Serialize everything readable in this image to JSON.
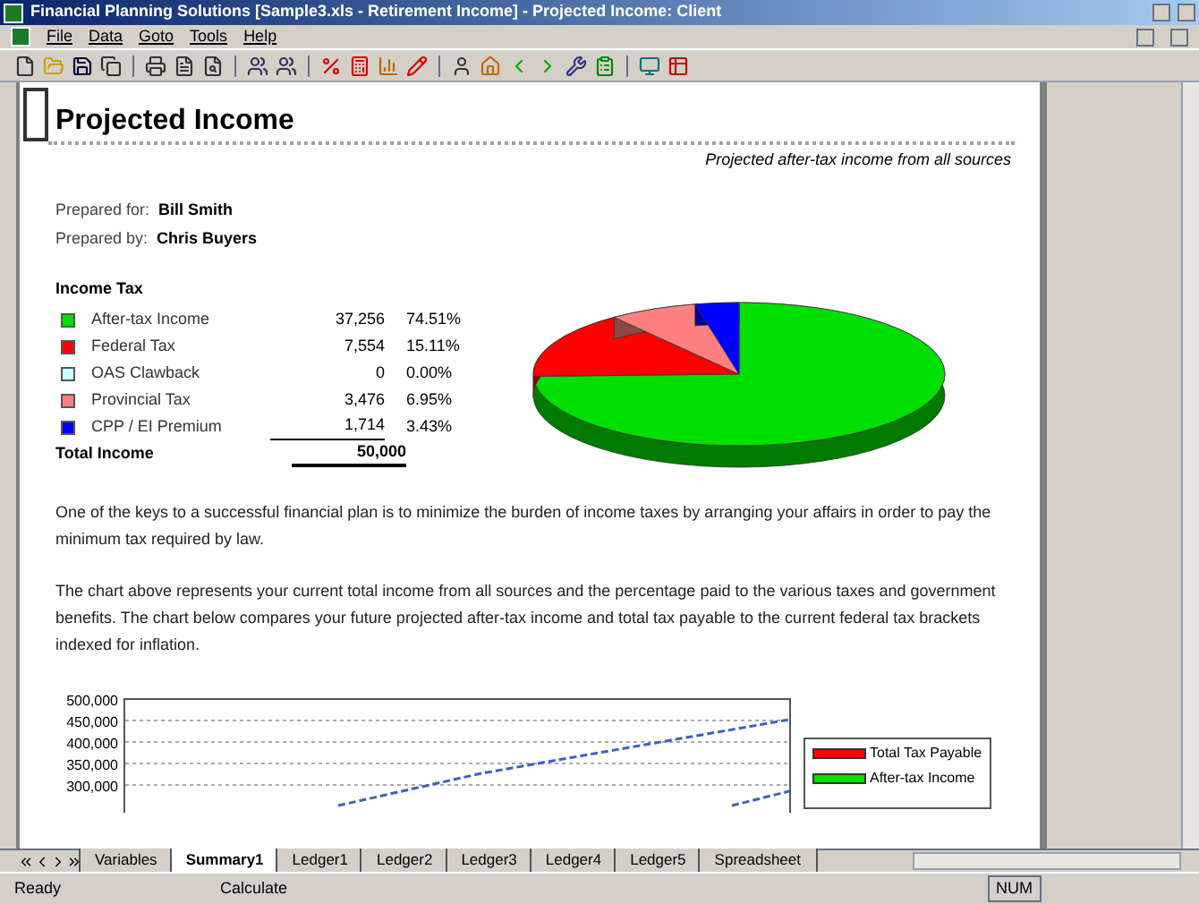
{
  "window": {
    "title": "Financial Planning Solutions [Sample3.xls - Retirement Income] - Projected Income: Client"
  },
  "menu": [
    "File",
    "Data",
    "Goto",
    "Tools",
    "Help"
  ],
  "report": {
    "title": "Projected Income",
    "subtitle": "Projected after-tax income from all sources",
    "prepared": [
      {
        "label": "Prepared for:",
        "value": "Bill Smith"
      },
      {
        "label": "Prepared by:",
        "value": "Chris Buyers"
      }
    ],
    "income_tax": {
      "heading": "Income Tax",
      "rows": [
        {
          "name": "After-tax Income",
          "amount": "37,256",
          "percent": "74.51%",
          "color": "#00e000"
        },
        {
          "name": "Federal Tax",
          "amount": "7,554",
          "percent": "15.11%",
          "color": "#ff0000"
        },
        {
          "name": "OAS Clawback",
          "amount": "0",
          "percent": "0.00%",
          "color": "#ccffff"
        },
        {
          "name": "Provincial Tax",
          "amount": "3,476",
          "percent": "6.95%",
          "color": "#ff8080"
        },
        {
          "name": "CPP / EI Premium",
          "amount": "1,714",
          "percent": "3.43%",
          "color": "#0000ff"
        }
      ],
      "total": {
        "label": "Total Income",
        "amount": "50,000"
      }
    },
    "paragraphs": [
      "One of the keys to a successful financial plan is to minimize the burden of income taxes by arranging your affairs in order to pay the minimum tax required by law.",
      "The chart above represents your current total income from all sources and the percentage paid to the various taxes and government benefits.  The chart below compares your future projected after-tax income and total tax payable to the current federal tax brackets indexed for inflation."
    ],
    "projection_chart": {
      "y_labels": [
        "500,000",
        "450,000",
        "400,000",
        "350,000",
        "300,000"
      ],
      "legend": [
        {
          "name": "Total Tax Payable",
          "color": "#ff0000"
        },
        {
          "name": "After-tax Income",
          "color": "#00e000"
        }
      ]
    }
  },
  "sheet_tabs": [
    {
      "label": "Variables",
      "selected": false
    },
    {
      "label": "Summary1",
      "selected": true
    },
    {
      "label": "Ledger1",
      "selected": false
    },
    {
      "label": "Ledger2",
      "selected": false
    },
    {
      "label": "Ledger3",
      "selected": false
    },
    {
      "label": "Ledger4",
      "selected": false
    },
    {
      "label": "Ledger5",
      "selected": false
    },
    {
      "label": "Spreadsheet",
      "selected": false
    }
  ],
  "status_bar": {
    "left": "Ready",
    "middle": "Calculate",
    "indicator": "NUM"
  }
}
